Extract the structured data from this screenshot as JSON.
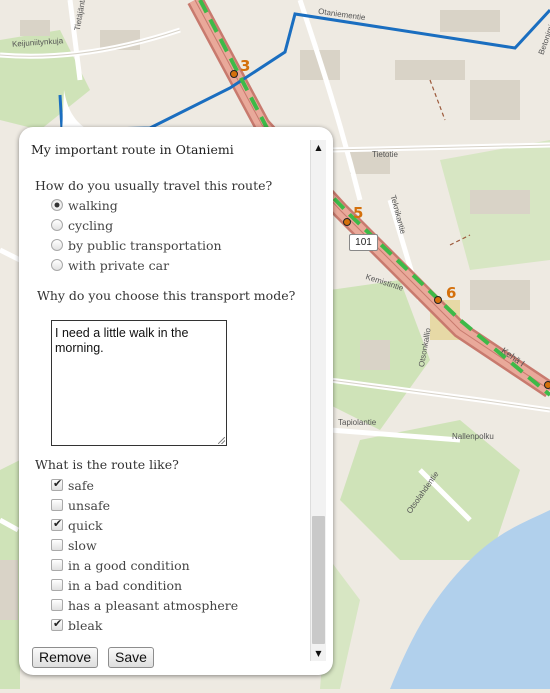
{
  "map": {
    "street_labels": [
      "Otaniementie",
      "Keijuniitynkuja",
      "Tietäjäntie",
      "Tietotie",
      "Betonimiehenkuja",
      "Teknikantie",
      "Kemistintie",
      "Kehä I",
      "Otsonkallio",
      "Tapiolantie",
      "Nallenpolku",
      "Otsolahdentie"
    ],
    "route_numbers": [
      "3",
      "5",
      "6"
    ],
    "road_number": "101",
    "colors": {
      "route": "#1a6ec0",
      "route_dashed": "#3dba48",
      "waypoint": "#d4700c",
      "highway": "#d3877b",
      "water": "#b1d0ec"
    }
  },
  "popup": {
    "title": "My important route in Otaniemi",
    "transport": {
      "question": "How do you usually travel this route?",
      "options": [
        {
          "label": "walking",
          "selected": true
        },
        {
          "label": "cycling",
          "selected": false
        },
        {
          "label": "by public transportation",
          "selected": false
        },
        {
          "label": "with private car",
          "selected": false
        }
      ]
    },
    "reason": {
      "question": "Why do you choose this transport mode?",
      "value": "I need a little walk in the morning."
    },
    "route_like": {
      "question": "What is the route like?",
      "options": [
        {
          "label": "safe",
          "checked": true
        },
        {
          "label": "unsafe",
          "checked": false
        },
        {
          "label": "quick",
          "checked": true
        },
        {
          "label": "slow",
          "checked": false
        },
        {
          "label": "in a good condition",
          "checked": false
        },
        {
          "label": "in a bad condition",
          "checked": false
        },
        {
          "label": "has a pleasant atmosphere",
          "checked": false
        },
        {
          "label": "bleak",
          "checked": true
        }
      ]
    },
    "buttons": {
      "remove": "Remove",
      "save": "Save"
    }
  }
}
